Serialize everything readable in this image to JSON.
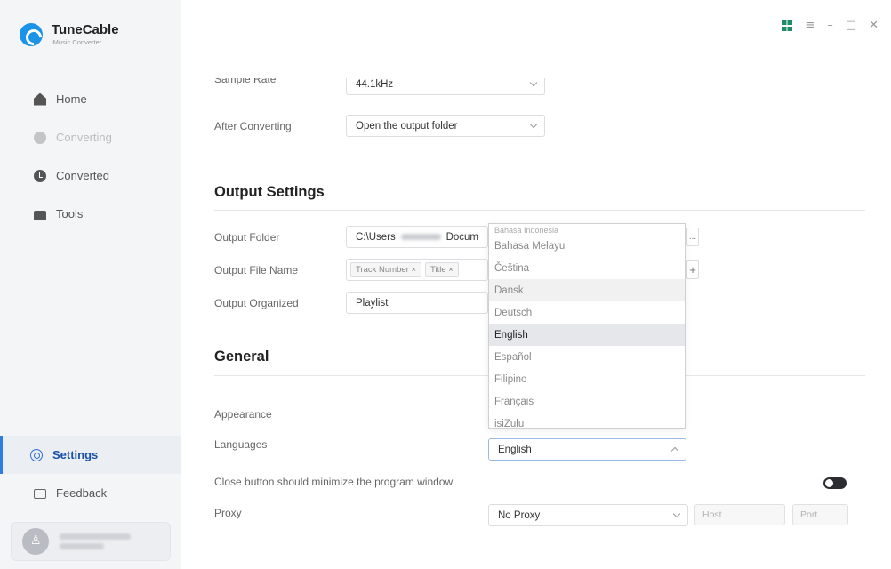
{
  "brand": {
    "name": "TuneCable",
    "subtitle": "iMusic Converter"
  },
  "sidebar": {
    "items": [
      {
        "label": "Home"
      },
      {
        "label": "Converting"
      },
      {
        "label": "Converted"
      },
      {
        "label": "Tools"
      }
    ],
    "bottom_items": [
      {
        "label": "Settings"
      },
      {
        "label": "Feedback"
      }
    ]
  },
  "window_controls": {
    "grid": "grid-view-icon",
    "menu": "≡",
    "minimize": "–",
    "maximize": "□",
    "close": "✕"
  },
  "convert": {
    "sample_rate_label": "Sample Rate",
    "sample_rate_value": "44.1kHz",
    "after_label": "After Converting",
    "after_value": "Open the output folder"
  },
  "output": {
    "title": "Output Settings",
    "folder_label": "Output Folder",
    "folder_value_prefix": "C:\\Users",
    "folder_value_suffix": "Docum",
    "folder_button": "...",
    "filename_label": "Output File Name",
    "filename_tags": [
      "Track Number ×",
      "Title ×"
    ],
    "filename_add": "+",
    "organized_label": "Output Organized",
    "organized_value": "Playlist"
  },
  "general": {
    "title": "General",
    "appearance_label": "Appearance",
    "languages_label": "Languages",
    "languages_value": "English",
    "close_label": "Close button should minimize the program window",
    "proxy_label": "Proxy",
    "proxy_value": "No Proxy",
    "host_placeholder": "Host",
    "port_placeholder": "Port"
  },
  "language_dropdown": {
    "partial_top": "Bahasa Indonesia",
    "options": [
      "Bahasa Melayu",
      "Čeština",
      "Dansk",
      "Deutsch",
      "English",
      "Español",
      "Filipino",
      "Français",
      "isiZulu"
    ],
    "hovered": "Dansk",
    "selected": "English"
  },
  "colors": {
    "accent": "#2f7de1",
    "brand": "#1a93e8",
    "sidebar_bg": "#f4f5f7"
  }
}
